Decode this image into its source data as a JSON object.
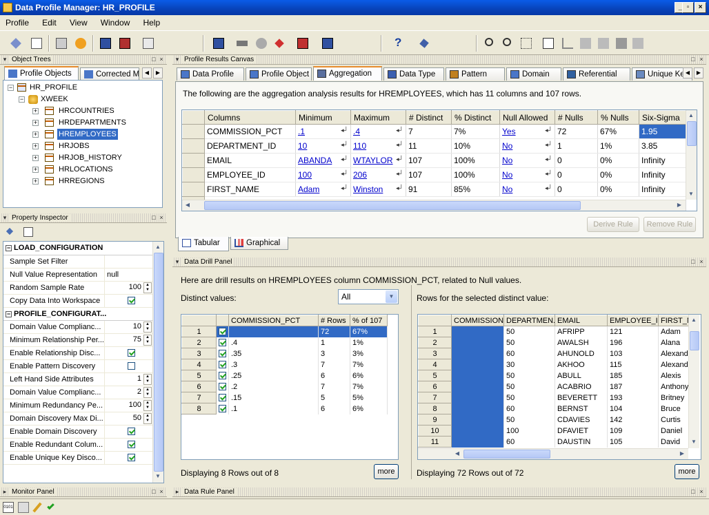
{
  "window": {
    "title": "Data Profile Manager: HR_PROFILE"
  },
  "menu": [
    "Profile",
    "Edit",
    "View",
    "Window",
    "Help"
  ],
  "panels": {
    "object_trees": "Object Trees",
    "profile_results": "Profile Results Canvas",
    "property_inspector": "Property Inspector",
    "data_drill": "Data Drill Panel",
    "monitor": "Monitor Panel",
    "data_rule": "Data Rule Panel"
  },
  "tree_tabs": [
    "Profile Objects",
    "Corrected M"
  ],
  "tree": {
    "root": "HR_PROFILE",
    "child": "XWEEK",
    "tables": [
      "HRCOUNTRIES",
      "HRDEPARTMENTS",
      "HREMPLOYEES",
      "HRJOBS",
      "HRJOB_HISTORY",
      "HRLOCATIONS",
      "HRREGIONS"
    ],
    "selected": "HREMPLOYEES"
  },
  "result_tabs": [
    "Data Profile",
    "Profile Object",
    "Aggregation",
    "Data Type",
    "Pattern",
    "Domain",
    "Referential",
    "Unique Key"
  ],
  "active_result_tab": "Aggregation",
  "aggregation": {
    "intro": "The following are the aggregation analysis results for HREMPLOYEES, which has 11 columns and 107 rows.",
    "headers": [
      "Columns",
      "Minimum",
      "Maximum",
      "# Distinct",
      "% Distinct",
      "Null Allowed",
      "# Nulls",
      "% Nulls",
      "Six-Sigma"
    ],
    "rows": [
      [
        "COMMISSION_PCT",
        ".1",
        ".4",
        "7",
        "7%",
        "Yes",
        "72",
        "67%",
        "1.95"
      ],
      [
        "DEPARTMENT_ID",
        "10",
        "110",
        "11",
        "10%",
        "No",
        "1",
        "1%",
        "3.85"
      ],
      [
        "EMAIL",
        "ABANDA",
        "WTAYLOR",
        "107",
        "100%",
        "No",
        "0",
        "0%",
        "Infinity"
      ],
      [
        "EMPLOYEE_ID",
        "100",
        "206",
        "107",
        "100%",
        "No",
        "0",
        "0%",
        "Infinity"
      ],
      [
        "FIRST_NAME",
        "Adam",
        "Winston",
        "91",
        "85%",
        "No",
        "0",
        "0%",
        "Infinity"
      ]
    ]
  },
  "buttons": {
    "derive_rule": "Derive Rule",
    "remove_rule": "Remove Rule",
    "more": "more"
  },
  "view_tabs": [
    "Tabular",
    "Graphical"
  ],
  "property_inspector": {
    "sections": [
      {
        "title": "LOAD_CONFIGURATION",
        "items": [
          {
            "label": "Sample Set Filter",
            "value": ""
          },
          {
            "label": "Null Value Representation",
            "value": "null"
          },
          {
            "label": "Random Sample Rate",
            "value": "100",
            "spin": true
          },
          {
            "label": "Copy Data Into Workspace",
            "check": true
          }
        ]
      },
      {
        "title": "PROFILE_CONFIGURAT...",
        "items": [
          {
            "label": "Domain Value Complianc...",
            "value": "10",
            "spin": true
          },
          {
            "label": "Minimum Relationship Per...",
            "value": "75",
            "spin": true
          },
          {
            "label": "Enable Relationship Disc...",
            "check": true
          },
          {
            "label": "Enable Pattern Discovery",
            "check": false
          },
          {
            "label": "Left Hand Side Attributes",
            "value": "1",
            "spin": true
          },
          {
            "label": "Domain Value Complianc...",
            "value": "2",
            "spin": true
          },
          {
            "label": "Minimum Redundancy Pe...",
            "value": "100",
            "spin": true
          },
          {
            "label": "Domain Discovery Max Di...",
            "value": "50",
            "spin": true
          },
          {
            "label": "Enable Domain Discovery",
            "check": true
          },
          {
            "label": "Enable Redundant Colum...",
            "check": true
          },
          {
            "label": "Enable Unique Key Disco...",
            "check": true
          }
        ]
      }
    ]
  },
  "drill": {
    "intro": "Here are drill results on HREMPLOYEES column COMMISSION_PCT, related to Null values.",
    "distinct_label": "Distinct values:",
    "filter_value": "All",
    "rows_label": "Rows for the selected distinct value:",
    "distinct_headers": [
      "COMMISSION_PCT",
      "# Rows",
      "% of 107"
    ],
    "distinct_rows": [
      [
        "",
        "72",
        "67%"
      ],
      [
        ".4",
        "1",
        "1%"
      ],
      [
        ".35",
        "3",
        "3%"
      ],
      [
        ".3",
        "7",
        "7%"
      ],
      [
        ".25",
        "6",
        "6%"
      ],
      [
        ".2",
        "7",
        "7%"
      ],
      [
        ".15",
        "5",
        "5%"
      ],
      [
        ".1",
        "6",
        "6%"
      ]
    ],
    "rows_headers": [
      "COMMISSION...",
      "DEPARTMEN...",
      "EMAIL",
      "EMPLOYEE_ID",
      "FIRST_N"
    ],
    "rows": [
      [
        "",
        "50",
        "AFRIPP",
        "121",
        "Adam"
      ],
      [
        "",
        "50",
        "AWALSH",
        "196",
        "Alana"
      ],
      [
        "",
        "60",
        "AHUNOLD",
        "103",
        "Alexand"
      ],
      [
        "",
        "30",
        "AKHOO",
        "115",
        "Alexand"
      ],
      [
        "",
        "50",
        "ABULL",
        "185",
        "Alexis"
      ],
      [
        "",
        "50",
        "ACABRIO",
        "187",
        "Anthony"
      ],
      [
        "",
        "50",
        "BEVERETT",
        "193",
        "Britney"
      ],
      [
        "",
        "60",
        "BERNST",
        "104",
        "Bruce"
      ],
      [
        "",
        "50",
        "CDAVIES",
        "142",
        "Curtis"
      ],
      [
        "",
        "100",
        "DFAVIET",
        "109",
        "Daniel"
      ],
      [
        "",
        "60",
        "DAUSTIN",
        "105",
        "David"
      ]
    ],
    "left_status": "Displaying 8 Rows out of 8",
    "right_status": "Displaying 72 Rows out of 72"
  }
}
